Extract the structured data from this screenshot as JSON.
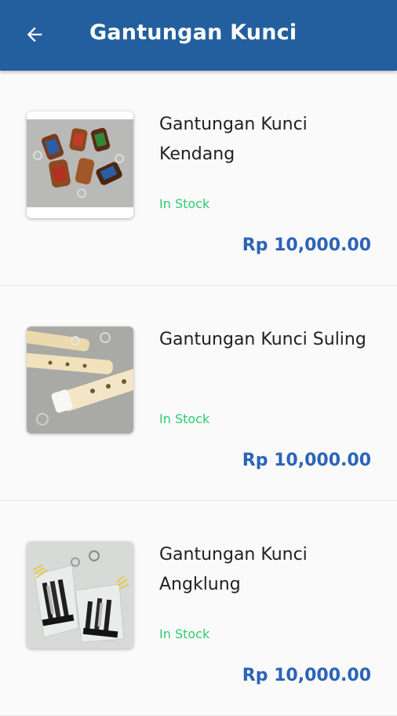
{
  "appbar": {
    "title": "Gantungan Kunci",
    "back_icon": "arrow-left-icon",
    "background_color": "#235f9e"
  },
  "products": [
    {
      "name": "Gantungan Kunci Kendang",
      "stock": "In Stock",
      "price": "Rp 10,000.00",
      "image": "kendang-keychain-photo"
    },
    {
      "name": "Gantungan Kunci Suling",
      "stock": "In Stock",
      "price": "Rp 10,000.00",
      "image": "suling-keychain-photo"
    },
    {
      "name": "Gantungan Kunci Angklung",
      "stock": "In Stock",
      "price": "Rp 10,000.00",
      "image": "angklung-keychain-photo"
    }
  ],
  "colors": {
    "stock": "#2ecc71",
    "price": "#2b63b8",
    "text": "#212121"
  }
}
